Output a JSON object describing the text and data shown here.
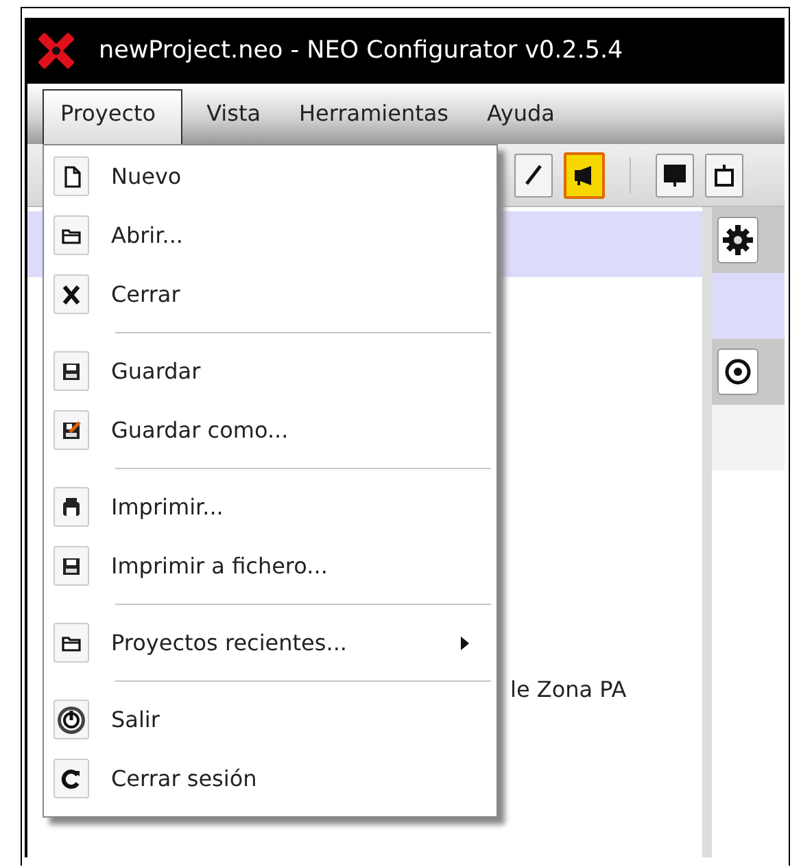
{
  "window": {
    "title": "newProject.neo - NEO Configurator v0.2.5.4"
  },
  "menubar": [
    {
      "label": "Proyecto",
      "selected": true
    },
    {
      "label": "Vista",
      "selected": false
    },
    {
      "label": "Herramientas",
      "selected": false
    },
    {
      "label": "Ayuda",
      "selected": false
    }
  ],
  "toolbar": [
    {
      "kind": "pencil"
    },
    {
      "kind": "megaphone"
    },
    {
      "kind": "separator"
    },
    {
      "kind": "monitor"
    },
    {
      "kind": "tv"
    }
  ],
  "content": {
    "text": "le Zona PA"
  },
  "menu": {
    "groups": [
      [
        {
          "label": "Nuevo",
          "kind": "document",
          "submenu": false
        },
        {
          "label": "Abrir...",
          "kind": "folder",
          "submenu": false
        },
        {
          "label": "Cerrar",
          "kind": "close",
          "submenu": false
        }
      ],
      [
        {
          "label": "Guardar",
          "kind": "floppy",
          "submenu": false
        },
        {
          "label": "Guardar como...",
          "kind": "floppy-pencil",
          "submenu": false
        }
      ],
      [
        {
          "label": "Imprimir...",
          "kind": "printer",
          "submenu": false
        },
        {
          "label": "Imprimir a fichero...",
          "kind": "floppy",
          "submenu": false
        }
      ],
      [
        {
          "label": "Proyectos recientes...",
          "kind": "folder",
          "submenu": true
        }
      ],
      [
        {
          "label": "Salir",
          "kind": "power",
          "submenu": false
        },
        {
          "label": "Cerrar sesión",
          "kind": "refresh",
          "submenu": false
        }
      ]
    ]
  }
}
